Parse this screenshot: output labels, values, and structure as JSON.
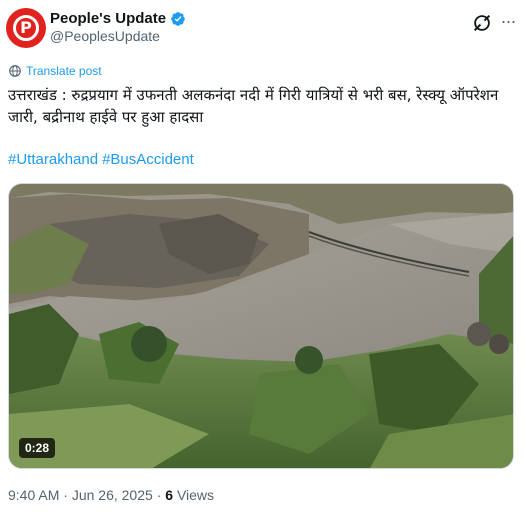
{
  "account": {
    "display_name": "People's Update",
    "handle": "@PeoplesUpdate",
    "avatar_letter": "P",
    "brand_color": "#e0231f",
    "verified_color": "#1d9bf0"
  },
  "translate": {
    "label": "Translate post",
    "icon": "globe-icon"
  },
  "tweet": {
    "text": "उत्तराखंड : रुद्रप्रयाग में उफनती अलकनंदा नदी में गिरी यात्रियों से भरी बस, रेस्क्यू ऑपरेशन जारी, बद्रीनाथ हाईवे पर हुआ हादसा",
    "hashtags": [
      "#Uttarakhand",
      "#BusAccident"
    ]
  },
  "media": {
    "duration": "0:28"
  },
  "meta": {
    "time": "9:40 AM",
    "separator": "·",
    "date": "Jun 26, 2025",
    "views_count": "6",
    "views_label": "Views"
  },
  "colors": {
    "link": "#1d9bf0",
    "secondary_text": "#536471",
    "primary_text": "#0f1419"
  }
}
